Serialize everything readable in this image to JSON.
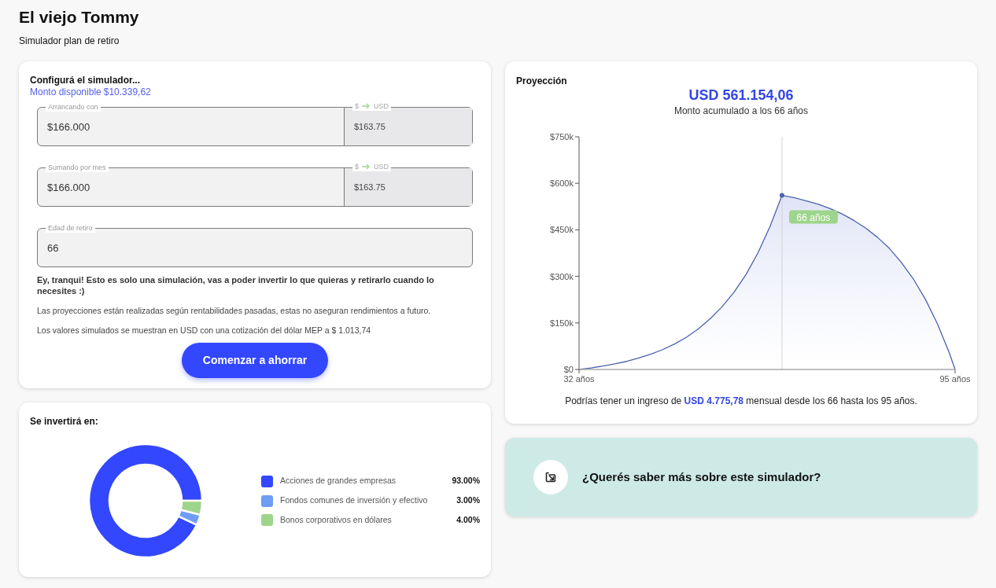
{
  "header": {
    "title": "El viejo Tommy",
    "subtitle": "Simulador plan de retiro"
  },
  "config": {
    "title": "Configurá el simulador...",
    "available_label": "Monto disponible",
    "available_value": "$10.339,62",
    "fields": [
      {
        "kind": "converted",
        "label": "Arrancando con",
        "value": "$166.000",
        "conversion_from": "$",
        "conversion_to": "USD",
        "converted": "$163.75"
      },
      {
        "kind": "converted",
        "label": "Sumando por mes",
        "value": "$166.000",
        "conversion_from": "$",
        "conversion_to": "USD",
        "converted": "$163.75"
      },
      {
        "kind": "plain",
        "label": "Edad de retiro",
        "value": "66"
      }
    ],
    "notice": "Ey, tranqui! Esto es solo una simulación, vas a poder invertir lo que quieras y retirarlo cuando lo necesites :)",
    "notes": [
      "Las proyecciones están realizadas según rentabilidades pasadas, estas no aseguran rendimientos a futuro.",
      "Los valores simulados se muestran en USD con una cotización del dólar MEP a $ 1.013,74"
    ],
    "button": "Comenzar a ahorrar"
  },
  "allocation": {
    "title": "Se invertirá en:",
    "legend": [
      {
        "percent": "93.00%",
        "color": "#3347ff"
      },
      {
        "percent": "3.00%",
        "color": "#6f9cf5"
      },
      {
        "percent": "4.00%",
        "color": "#9ed58c"
      }
    ],
    "chart_data": {
      "type": "donut",
      "categories": [
        "Acciones de grandes empresas",
        "Fondos comunes de inversión y efectivo",
        "Bonos corporativos en dólares"
      ],
      "values": [
        93,
        3,
        4
      ]
    }
  },
  "projection": {
    "title": "Proyección",
    "amount": "USD 561.154,06",
    "caption": "Monto acumulado a los 66 años",
    "chart_data": {
      "type": "area",
      "x": [
        32,
        34,
        36,
        38,
        40,
        42,
        44,
        46,
        48,
        50,
        52,
        54,
        56,
        58,
        60,
        62,
        64,
        66,
        68,
        70,
        72,
        74,
        76,
        78,
        80,
        82,
        84,
        86,
        88,
        90,
        92,
        94,
        95
      ],
      "series": [
        {
          "color": "#4a62ad",
          "values": [
            0,
            5000,
            11000,
            18000,
            26000,
            37000,
            49000,
            64000,
            82000,
            104000,
            131000,
            164000,
            203000,
            250000,
            307000,
            377000,
            461000,
            561000,
            554000,
            544000,
            533000,
            519000,
            502000,
            481000,
            456000,
            426000,
            390000,
            345000,
            292000,
            227000,
            149000,
            55000,
            0
          ]
        }
      ],
      "ref_lines": [
        {
          "axis": "x",
          "value": 66
        }
      ],
      "xlim": [
        32,
        95
      ],
      "ylim": [
        0,
        750000
      ],
      "xticks": [
        {
          "value": 32,
          "label": "32 años"
        },
        {
          "value": 95,
          "label": "95 años"
        }
      ],
      "yticks": [
        {
          "value": 0,
          "label": "$0"
        },
        {
          "value": 150000,
          "label": "$150k"
        },
        {
          "value": 300000,
          "label": "$300k"
        },
        {
          "value": 450000,
          "label": "$450k"
        },
        {
          "value": 600000,
          "label": "$600k"
        },
        {
          "value": 750000,
          "label": "$750k"
        }
      ],
      "annotations": [
        "66 años"
      ]
    },
    "income_text": "Podrías tener un ingreso de **USD 4.775,78** mensual desde los 66 hasta los 95 años."
  },
  "info_banner": {
    "text": "¿Querés saber más sobre este simulador?"
  }
}
